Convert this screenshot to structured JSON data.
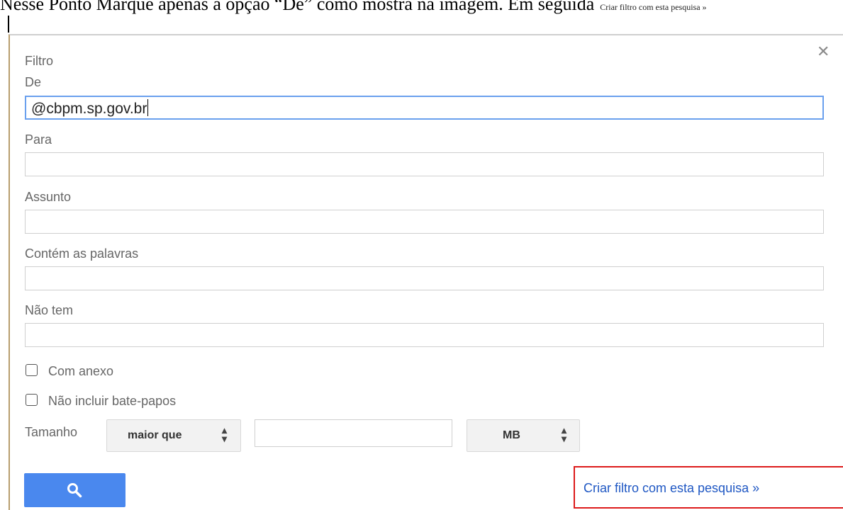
{
  "caption": {
    "text": "Nesse Ponto Marque apenas a opção “De” como mostra na imagem. Em seguida",
    "small": "Criar filtro com esta pesquisa »"
  },
  "dialog": {
    "title": "Filtro",
    "close_icon": "close-icon",
    "fields": {
      "from": {
        "label": "De",
        "value": "@cbpm.sp.gov.br"
      },
      "to": {
        "label": "Para",
        "value": ""
      },
      "subject": {
        "label": "Assunto",
        "value": ""
      },
      "has_words": {
        "label": "Contém as palavras",
        "value": ""
      },
      "doesnt_have": {
        "label": "Não tem",
        "value": ""
      }
    },
    "checkboxes": {
      "has_attachment": {
        "label": "Com anexo",
        "checked": false
      },
      "no_chats": {
        "label": "Não incluir bate-papos",
        "checked": false
      }
    },
    "size": {
      "label": "Tamanho",
      "operator": "maior que",
      "value": "",
      "unit": "MB"
    },
    "search_button_icon": "search-icon",
    "create_filter_link": "Criar filtro com esta pesquisa »"
  },
  "colors": {
    "accent_blue": "#4a88ee",
    "link_blue": "#1f57c3",
    "highlight_red": "#dd1b1b",
    "focus_border": "#6aa0ee"
  }
}
